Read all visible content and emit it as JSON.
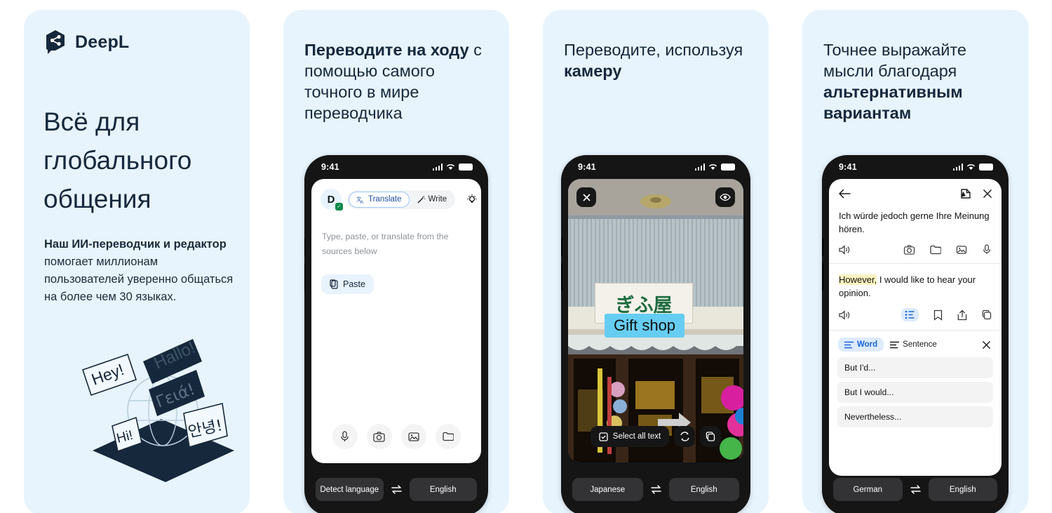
{
  "page": {
    "background": "#ffffff",
    "card_background": "#e7f4fd",
    "accent_blue": "#1a62d6",
    "ink": "#16283c"
  },
  "card1": {
    "logo_text": "DeepL",
    "logo_icon": "deepl-logo-icon",
    "headline": "Всё для глобального общения",
    "body_bold": "Наш ИИ-переводчик и редактор",
    "body_rest": " помогает миллионам пользователей уверенно общаться на более чем 30 языках.",
    "illustration": {
      "name": "isometric-globe-speech-bubbles",
      "bubbles": [
        "Hallo!",
        "Hey!",
        "Γειά!",
        "Hi!",
        "안녕!"
      ]
    }
  },
  "card2": {
    "headline_bold": "Переводите на ходу",
    "headline_rest": " с помощью самого точного в мире переводчика",
    "phone": {
      "status": {
        "time": "9:41",
        "signal_icon": "cellular-bars-icon",
        "wifi_icon": "wifi-icon",
        "battery_icon": "battery-icon"
      },
      "avatar_letter": "D",
      "avatar_badge_icon": "verified-shield-icon",
      "tabs": [
        {
          "label": "Translate",
          "icon": "translate-icon",
          "active": true
        },
        {
          "label": "Write",
          "icon": "magic-wand-icon",
          "active": false
        }
      ],
      "bulb_icon": "lightbulb-icon",
      "bookmark_icon": "bookmark-filled-icon",
      "placeholder": "Type, paste, or translate from the sources below",
      "paste_label": "Paste",
      "paste_icon": "clipboard-icon",
      "actions": [
        "microphone-icon",
        "camera-icon",
        "image-icon",
        "folder-icon"
      ],
      "source_lang": "Detect language",
      "target_lang": "English",
      "swap_icon": "swap-arrows-icon"
    }
  },
  "card3": {
    "headline_rest": "Переводите, используя ",
    "headline_bold": "камеру",
    "phone": {
      "status": {
        "time": "9:41",
        "signal_icon": "cellular-bars-icon",
        "wifi_icon": "wifi-icon",
        "battery_icon": "battery-icon"
      },
      "close_icon": "close-icon",
      "eye_icon": "eye-icon",
      "sign_text": "ぎふ屋",
      "overlay_text": "Gift shop",
      "select_all_label": "Select all text",
      "select_all_icon": "select-all-icon",
      "refresh_icon": "refresh-icon",
      "copy_icon": "copy-icon",
      "source_lang": "Japanese",
      "target_lang": "English",
      "swap_icon": "swap-arrows-icon"
    }
  },
  "card4": {
    "headline_rest": "Точнее выражайте мысли благодаря ",
    "headline_bold": "альтернативным вариантам",
    "phone": {
      "status": {
        "time": "9:41",
        "signal_icon": "cellular-bars-icon",
        "wifi_icon": "wifi-icon",
        "battery_icon": "battery-icon"
      },
      "back_icon": "back-arrow-icon",
      "glossary_icon": "glossary-icon",
      "close_icon": "close-icon",
      "source_text": "Ich würde jedoch gerne Ihre Meinung hören.",
      "source_icons": [
        "speaker-icon",
        "camera-icon",
        "folder-icon",
        "image-icon",
        "microphone-icon"
      ],
      "target_highlight": "However,",
      "target_text": " I would like to hear your opinion.",
      "target_icons": [
        "speaker-icon",
        "alternatives-icon",
        "bookmark-icon",
        "share-icon",
        "copy-icon"
      ],
      "alt_tabs": [
        {
          "label": "Word",
          "icon": "word-lines-icon",
          "active": true
        },
        {
          "label": "Sentence",
          "icon": "sentence-lines-icon",
          "active": false
        }
      ],
      "alt_close_icon": "close-icon",
      "alternatives": [
        "But I'd...",
        "But I would...",
        "Nevertheless..."
      ],
      "source_lang": "German",
      "target_lang": "English",
      "swap_icon": "swap-arrows-icon"
    }
  }
}
